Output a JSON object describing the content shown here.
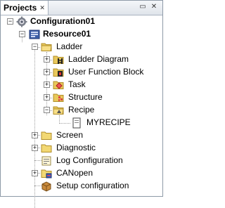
{
  "panel": {
    "tab_title": "Projects",
    "tab_close_glyph": "✕",
    "minimize_glyph": "▭",
    "close_glyph": "✕"
  },
  "tree": {
    "root": {
      "label": "Configuration01",
      "expanded": true,
      "icon": "gear-icon"
    },
    "resource": {
      "label": "Resource01",
      "expanded": true,
      "icon": "resource-icon"
    },
    "ladder": {
      "label": "Ladder",
      "expanded": true,
      "icon": "folder-icon"
    },
    "ladder_children": [
      {
        "label": "Ladder Diagram",
        "expander": "+",
        "icon": "ladder-diagram-folder-icon"
      },
      {
        "label": "User Function Block",
        "expander": "+",
        "icon": "function-block-folder-icon"
      },
      {
        "label": "Task",
        "expander": "+",
        "icon": "task-folder-icon"
      },
      {
        "label": "Structure",
        "expander": "+",
        "icon": "structure-folder-icon"
      },
      {
        "label": "Recipe",
        "expander": "−",
        "icon": "recipe-folder-icon"
      }
    ],
    "recipe_child": {
      "label": "MYRECIPE",
      "icon": "document-icon"
    },
    "resource_children": [
      {
        "label": "Screen",
        "expander": "+",
        "icon": "folder-icon"
      },
      {
        "label": "Diagnostic",
        "expander": "+",
        "icon": "folder-icon"
      },
      {
        "label": "Log Configuration",
        "expander": "",
        "icon": "log-config-icon"
      },
      {
        "label": "CANopen",
        "expander": "+",
        "icon": "canopen-folder-icon"
      },
      {
        "label": "Setup configuration",
        "expander": "",
        "icon": "setup-box-icon"
      }
    ]
  }
}
